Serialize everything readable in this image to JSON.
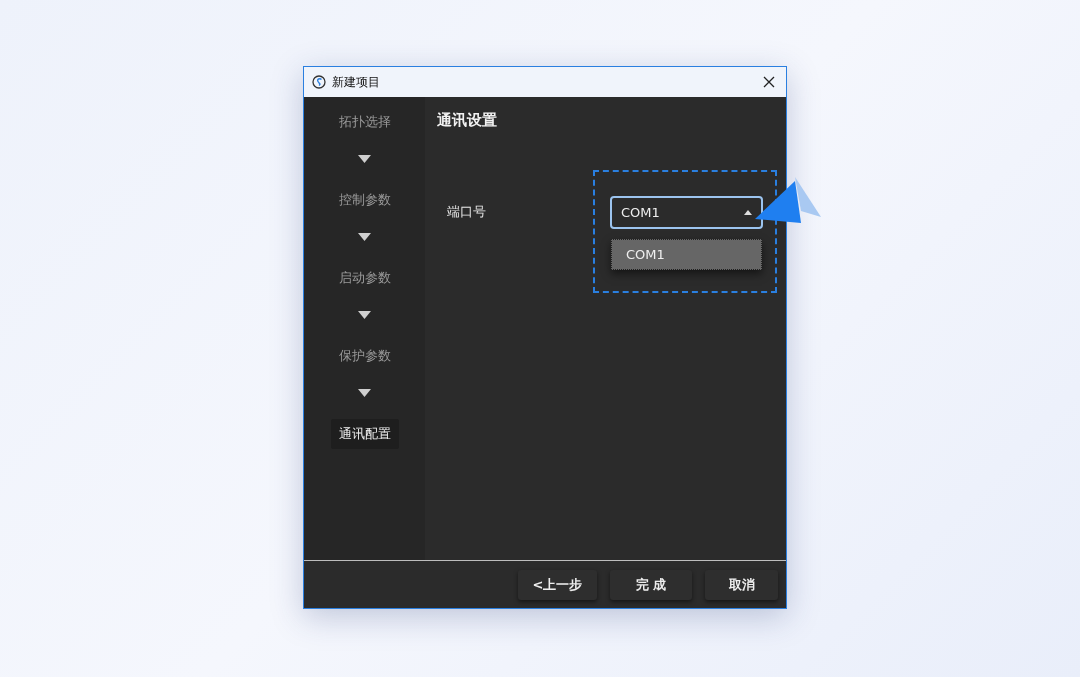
{
  "window": {
    "title": "新建项目"
  },
  "steps": [
    {
      "label": "拓扑选择",
      "selected": false
    },
    {
      "label": "控制参数",
      "selected": false
    },
    {
      "label": "启动参数",
      "selected": false
    },
    {
      "label": "保护参数",
      "selected": false
    },
    {
      "label": "通讯配置",
      "selected": true
    }
  ],
  "section": {
    "title": "通讯设置"
  },
  "field": {
    "label": "端口号",
    "value": "COM1",
    "expanded": true,
    "options": [
      {
        "label": "COM1",
        "selected": true
      }
    ]
  },
  "buttons": [
    {
      "label": "<上一步"
    },
    {
      "label": "完 成"
    },
    {
      "label": "取消"
    }
  ]
}
